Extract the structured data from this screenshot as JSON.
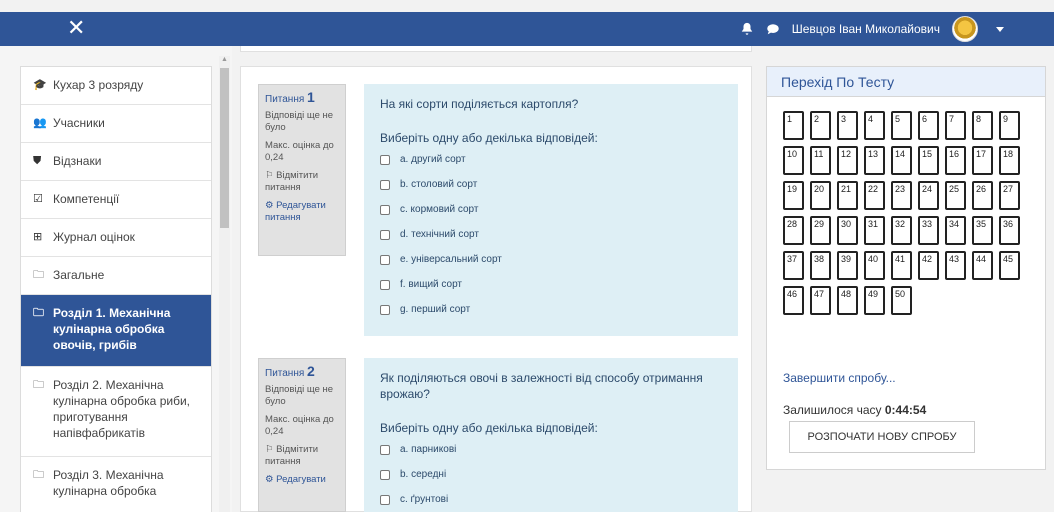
{
  "header": {
    "user_name": "Шевцов Іван Миколайович",
    "close_glyph": "✕",
    "bell_icon": "bell-icon",
    "chat_icon": "chat-icon"
  },
  "sidebar": {
    "items": [
      {
        "icon": "graduation-cap-icon",
        "glyph": "🎓",
        "label": "Кухар 3 розряду"
      },
      {
        "icon": "users-icon",
        "glyph": "👥",
        "label": "Учасники"
      },
      {
        "icon": "shield-icon",
        "glyph": "⛊",
        "label": "Відзнаки"
      },
      {
        "icon": "checkbox-icon",
        "glyph": "☑",
        "label": "Компетенції"
      },
      {
        "icon": "table-icon",
        "glyph": "⊞",
        "label": "Журнал оцінок"
      },
      {
        "icon": "folder-icon",
        "glyph": "🗀",
        "label": "Загальне"
      },
      {
        "icon": "folder-icon",
        "glyph": "🗀",
        "label": "Розділ 1. Механічна кулінарна обробка овочів, грибів"
      },
      {
        "icon": "folder-icon",
        "glyph": "🗀",
        "label": "Розділ 2. Механічна кулінарна обробка риби, приготування напівфабрикатів"
      },
      {
        "icon": "folder-icon",
        "glyph": "🗀",
        "label": "Розділ 3. Механічна кулінарна обробка"
      }
    ]
  },
  "questions": [
    {
      "label": "Питання",
      "number": "1",
      "status": "Відповіді ще не було",
      "max_grade": "Макс. оцінка до 0,24",
      "flag": "Відмітити питання",
      "edit": "Редагувати питання",
      "text": "На які сорти поділяється картопля?",
      "prompt": "Виберіть одну або декілька відповідей:",
      "options": [
        "a. другий сорт",
        "b. столовий сорт",
        "c. кормовий сорт",
        "d. технічний сорт",
        "e. універсальний сорт",
        "f. вищий сорт",
        "g. перший сорт"
      ]
    },
    {
      "label": "Питання",
      "number": "2",
      "status": "Відповіді ще не було",
      "max_grade": "Макс. оцінка до 0,24",
      "flag": "Відмітити питання",
      "edit": "Редагувати",
      "text": "Як поділяються овочі в залежності від способу отримання врожаю?",
      "prompt": "Виберіть одну або декілька відповідей:",
      "options": [
        "a. парникові",
        "b. середні",
        "c. ґрунтові"
      ]
    }
  ],
  "quiz_nav": {
    "title": "Перехід По Тесту",
    "numbers": [
      "1",
      "2",
      "3",
      "4",
      "5",
      "6",
      "7",
      "8",
      "9",
      "10",
      "11",
      "12",
      "13",
      "14",
      "15",
      "16",
      "17",
      "18",
      "19",
      "20",
      "21",
      "22",
      "23",
      "24",
      "25",
      "26",
      "27",
      "28",
      "29",
      "30",
      "31",
      "32",
      "33",
      "34",
      "35",
      "36",
      "37",
      "38",
      "39",
      "40",
      "41",
      "42",
      "43",
      "44",
      "45",
      "46",
      "47",
      "48",
      "49",
      "50"
    ],
    "finish": "Завершити спробу...",
    "time_left_label": "Залишилося часу",
    "time_left": "0:44:54",
    "restart": "РОЗПОЧАТИ НОВУ СПРОБУ"
  }
}
